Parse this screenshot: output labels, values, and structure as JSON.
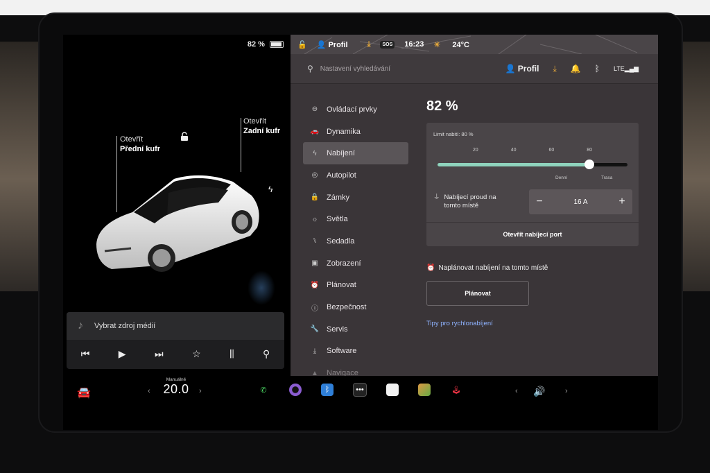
{
  "car": {
    "battery_pct": "82 %",
    "battery_level": 0.82,
    "front_trunk": {
      "line1": "Otevřít",
      "line2": "Přední kufr"
    },
    "rear_trunk": {
      "line1": "Otevřít",
      "line2": "Zadní kufr"
    },
    "lock_icon": "unlock-icon",
    "charge_icon": "lightning-icon"
  },
  "media": {
    "source_label": "Vybrat zdroj médií",
    "controls": [
      "prev-icon",
      "play-icon",
      "next-icon",
      "star-icon",
      "equalizer-icon",
      "search-icon"
    ]
  },
  "status": {
    "profile": "Profil",
    "sos": "SOS",
    "time": "16:23",
    "temperature": "24°C"
  },
  "search": {
    "placeholder": "Nastavení vyhledávání",
    "profile": "Profil"
  },
  "menu": [
    {
      "label": "Ovládací prvky",
      "icon": "toggle-icon"
    },
    {
      "label": "Dynamika",
      "icon": "car-icon"
    },
    {
      "label": "Nabíjení",
      "icon": "lightning-icon"
    },
    {
      "label": "Autopilot",
      "icon": "steering-wheel-icon"
    },
    {
      "label": "Zámky",
      "icon": "lock-icon"
    },
    {
      "label": "Světla",
      "icon": "sun-icon"
    },
    {
      "label": "Sedadla",
      "icon": "seat-icon"
    },
    {
      "label": "Zobrazení",
      "icon": "display-icon"
    },
    {
      "label": "Plánovat",
      "icon": "alarm-icon"
    },
    {
      "label": "Bezpečnost",
      "icon": "info-icon"
    },
    {
      "label": "Servis",
      "icon": "wrench-icon"
    },
    {
      "label": "Software",
      "icon": "download-icon"
    },
    {
      "label": "Navigace",
      "icon": "navigation-icon"
    }
  ],
  "charging": {
    "percent": "82 %",
    "limit_label": "Limit nabití: 80 %",
    "limit_value": 80,
    "ticks": [
      "20",
      "40",
      "60",
      "80"
    ],
    "zone_daily": "Denní",
    "zone_trip": "Trasa",
    "current_label_1": "Nabíjecí proud na",
    "current_label_2": "tomto místě",
    "current_value": "16 A",
    "minus": "−",
    "plus": "+",
    "open_port": "Otevřít nabíjecí port",
    "schedule_label": "Naplánovat nabíjení na tomto místě",
    "plan_button": "Plánovat",
    "tips_link": "Tipy pro rychlonabíjení"
  },
  "taskbar": {
    "mode": "Manuálně",
    "temp": "20.0",
    "left_arrow": "‹",
    "right_arrow": "›",
    "apps": [
      "phone-icon",
      "camera-icon",
      "bluetooth-icon",
      "more-icon",
      "notes-icon",
      "toybox-icon",
      "joystick-icon"
    ]
  }
}
